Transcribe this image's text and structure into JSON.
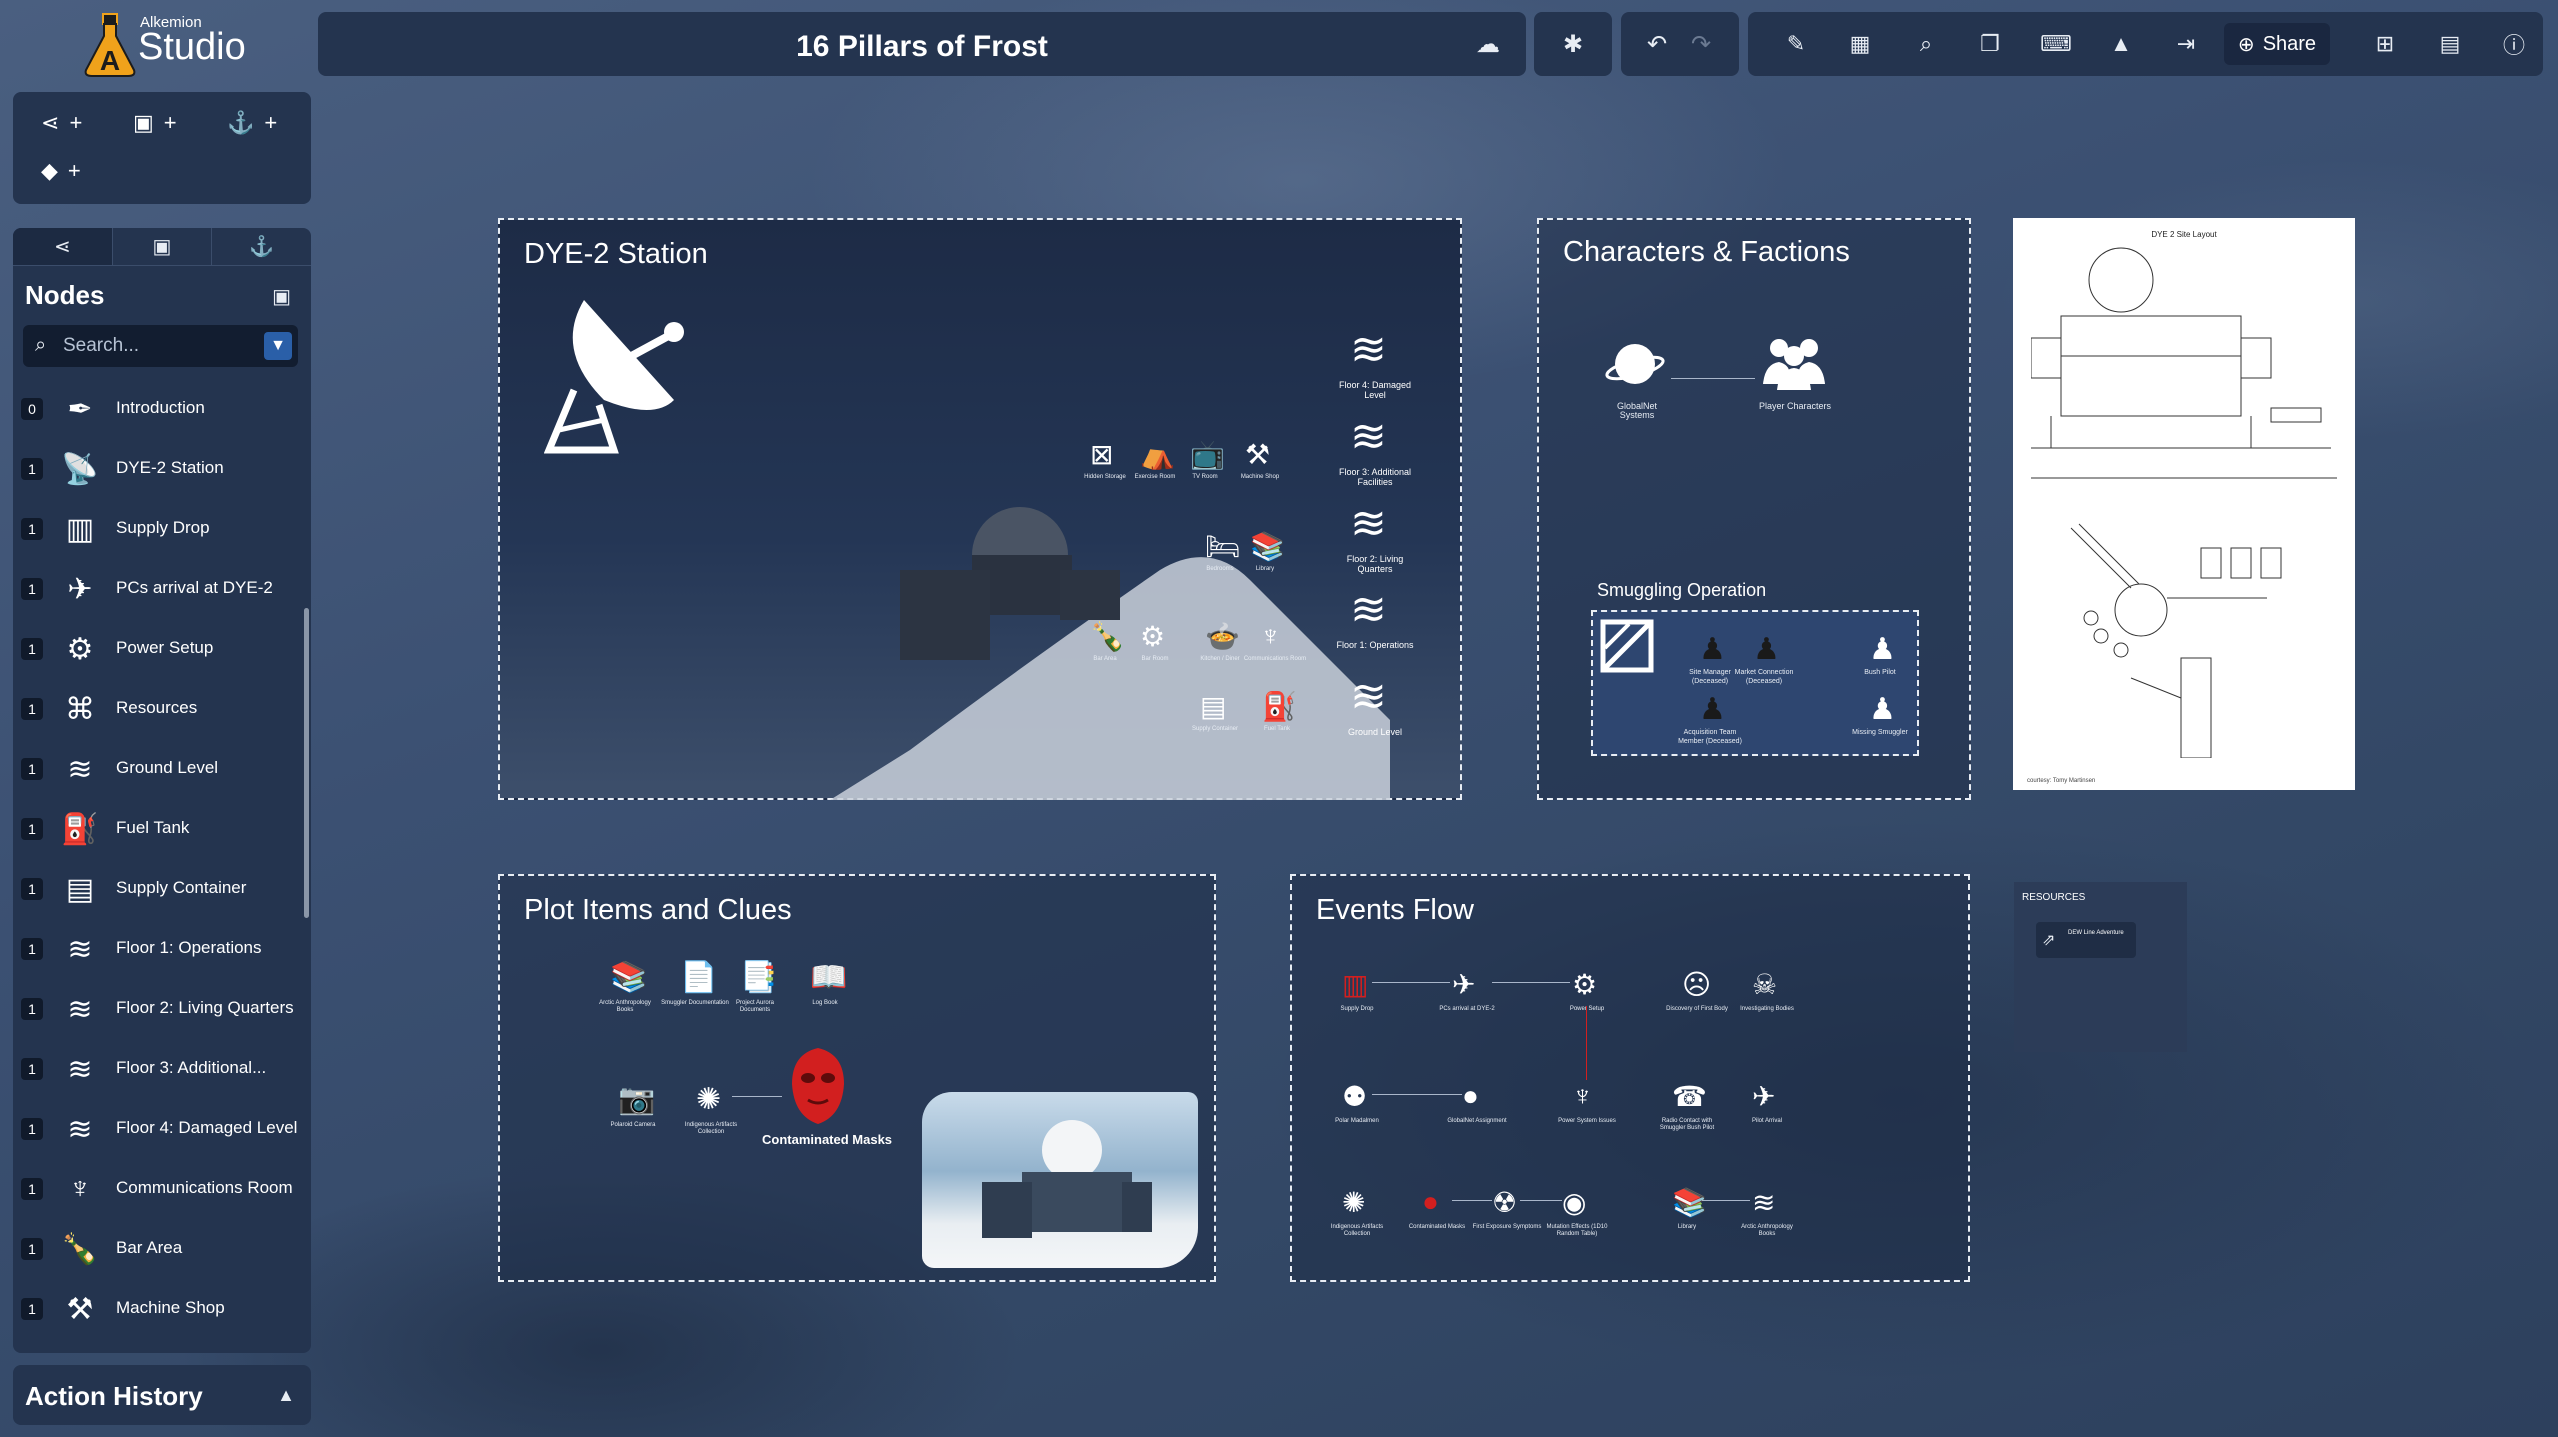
{
  "app": {
    "brand_small": "Alkemion",
    "brand_big": "Studio",
    "project_title": "16 Pillars of Frost"
  },
  "toolbar": {
    "share_label": "Share",
    "icons": [
      "cloud-check-icon",
      "bug-off-icon",
      "undo-icon",
      "redo-icon",
      "note-edit-icon",
      "table-icon",
      "search-icon",
      "copy-icon",
      "keyboard-icon",
      "shapes-icon",
      "export-icon",
      "globe-icon",
      "grid-icon",
      "book-icon",
      "info-icon"
    ]
  },
  "add_panel": {
    "items": [
      "node",
      "image",
      "anchor",
      "shapes"
    ]
  },
  "sidebar": {
    "tabs": [
      "nodes",
      "images",
      "anchors"
    ],
    "title": "Nodes",
    "search_placeholder": "Search...",
    "nodes": [
      {
        "count": "0",
        "label": "Introduction",
        "icon": "feather-icon"
      },
      {
        "count": "1",
        "label": "DYE-2 Station",
        "icon": "satellite-dish-icon"
      },
      {
        "count": "1",
        "label": "Supply Drop",
        "icon": "crate-drop-icon"
      },
      {
        "count": "1",
        "label": "PCs arrival at DYE-2",
        "icon": "helicopter-icon"
      },
      {
        "count": "1",
        "label": "Power Setup",
        "icon": "generator-icon"
      },
      {
        "count": "1",
        "label": "Resources",
        "icon": "network-icon"
      },
      {
        "count": "1",
        "label": "Ground Level",
        "icon": "layers-icon"
      },
      {
        "count": "1",
        "label": "Fuel Tank",
        "icon": "fuel-tank-icon"
      },
      {
        "count": "1",
        "label": "Supply Container",
        "icon": "container-icon"
      },
      {
        "count": "1",
        "label": "Floor 1: Operations",
        "icon": "layers-icon"
      },
      {
        "count": "1",
        "label": "Floor 2: Living Quarters",
        "icon": "layers-icon"
      },
      {
        "count": "1",
        "label": "Floor 3: Additional...",
        "icon": "layers-icon"
      },
      {
        "count": "1",
        "label": "Floor 4: Damaged Level",
        "icon": "layers-icon"
      },
      {
        "count": "1",
        "label": "Communications Room",
        "icon": "radio-tower-icon"
      },
      {
        "count": "1",
        "label": "Bar Area",
        "icon": "bottle-glass-icon"
      },
      {
        "count": "1",
        "label": "Machine Shop",
        "icon": "machine-shop-icon"
      }
    ]
  },
  "history": {
    "title": "Action History"
  },
  "canvas": {
    "dye2": {
      "title": "DYE-2 Station",
      "levels": [
        "Floor 4: Damaged Level",
        "Floor 3: Additional Facilities",
        "Floor 2: Living Quarters",
        "Floor 1: Operations",
        "Ground Level"
      ],
      "rooms": {
        "row1": [
          "Hidden Storage",
          "Exercise Room",
          "TV Room",
          "Machine Shop"
        ],
        "row2": [
          "Bedrooms",
          "Library"
        ],
        "row3": [
          "Bar Area",
          "Bar Room",
          "Kitchen / Diner",
          "Communications Room"
        ],
        "row4": [
          "Supply Container",
          "Fuel Tank"
        ]
      }
    },
    "characters": {
      "title": "Characters & Factions",
      "nodes": [
        "GlobalNet Systems",
        "Player Characters"
      ],
      "subgroup_title": "Smuggling Operation",
      "sub_nodes": [
        "Site Manager (Deceased)",
        "Market Connection (Deceased)",
        "Bush Pilot",
        "Acquisition Team Member (Deceased)",
        "Missing Smuggler"
      ]
    },
    "plot": {
      "title": "Plot Items and Clues",
      "items": [
        "Arctic Anthropology Books",
        "Smuggler Documentation",
        "Project Aurora Documents",
        "Log Book",
        "Polaroid Camera",
        "Indigenous Artifacts Collection"
      ],
      "highlight": "Contaminated Masks"
    },
    "events": {
      "title": "Events Flow",
      "row1": [
        "Supply Drop",
        "PCs arrival at DYE-2",
        "Power Setup",
        "Discovery of First Body",
        "Investigating Bodies"
      ],
      "row2": [
        "Polar Madalmen",
        "GlobalNet Assignment",
        "Power System Issues",
        "Radio Contact with Smuggler Bush Pilot",
        "Pilot Arrival"
      ],
      "row3": [
        "Indigenous Artifacts Collection",
        "Contaminated Masks",
        "First Exposure Symptoms",
        "Mutation Effects (1D10 Random Table)",
        "Library",
        "Arctic Anthropology Books"
      ]
    },
    "document": {
      "title": "DYE 2 Site Layout",
      "caption": "courtesy: Tomy Martinsen"
    },
    "resources": {
      "title": "RESOURCES",
      "link_label": "DEW Line Adventure"
    },
    "colors": {
      "accent_red": "#d21f1f",
      "panel": "#24344f",
      "filter_blue": "#2a5fa8"
    }
  }
}
